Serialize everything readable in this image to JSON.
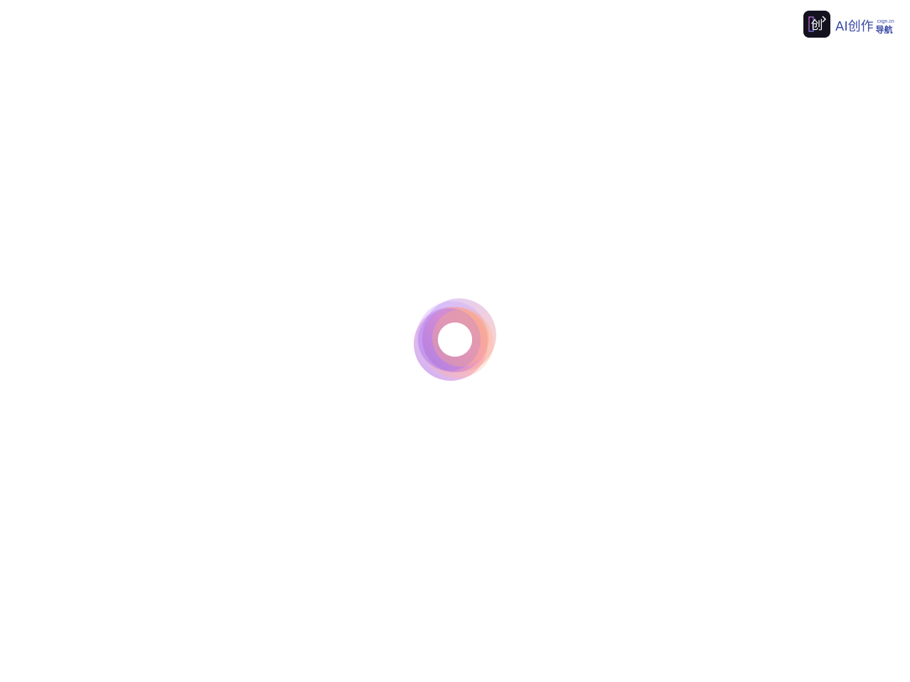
{
  "brand": {
    "logo_glyph": "创",
    "main_text": "AI创作",
    "domain_text": "cxgn.cn",
    "sub_text": "导航"
  },
  "loader": {
    "icon": "spinner-icon",
    "colors": {
      "purple": "#9b6cf2",
      "pink": "#f48fc0",
      "orange": "#ffad7a"
    }
  },
  "colors": {
    "background": "#ffffff",
    "brand_text": "#3b4aa6",
    "brand_tile": "#14121f"
  }
}
